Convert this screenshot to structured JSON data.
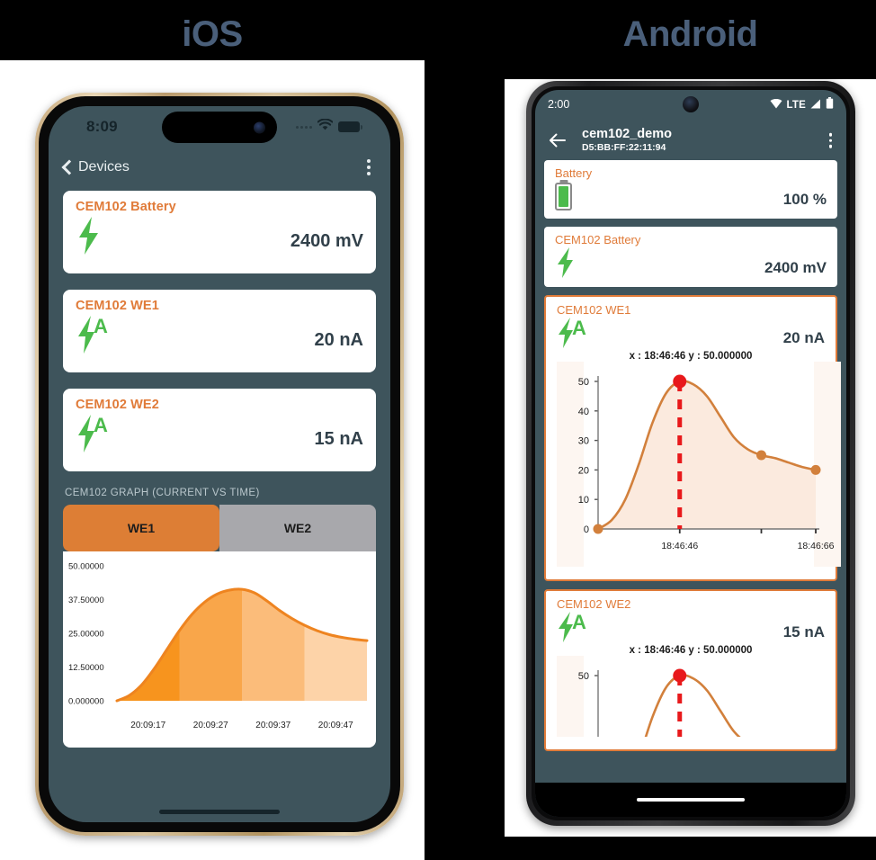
{
  "titles": {
    "ios": "iOS",
    "android": "Android"
  },
  "colors": {
    "app_background_teal": "#3e545c",
    "accent_orange": "#e07b39",
    "tab_active_orange": "#dd7e35",
    "tab_inactive_gray": "#a8a8ac",
    "value_text": "#31404a",
    "bolt_green": "#4cbb4c",
    "marker_red": "#e8191b",
    "platform_title": "#4a5f7a"
  },
  "ios": {
    "status_bar": {
      "time": "8:09",
      "icons": [
        "cellular-dots-icon",
        "wifi-icon",
        "battery-icon"
      ]
    },
    "nav_bar": {
      "back_label": "Devices",
      "back_icon": "chevron-left-icon",
      "overflow_icon": "overflow-menu-icon"
    },
    "cards": [
      {
        "title": "CEM102 Battery",
        "value": "2400 mV",
        "icon": "bolt-icon"
      },
      {
        "title": "CEM102 WE1",
        "value": "20 nA",
        "icon": "bolt-amp-icon"
      },
      {
        "title": "CEM102 WE2",
        "value": "15 nA",
        "icon": "bolt-amp-icon"
      }
    ],
    "graph": {
      "section_label": "CEM102 GRAPH (CURRENT VS TIME)",
      "tabs": [
        {
          "label": "WE1",
          "active": true
        },
        {
          "label": "WE2",
          "active": false
        }
      ]
    }
  },
  "android": {
    "status_bar": {
      "time": "2:00",
      "network_label": "LTE",
      "icons": [
        "wifi-icon",
        "signal-icon",
        "battery-icon"
      ]
    },
    "app_bar": {
      "back_icon": "arrow-left-icon",
      "title": "cem102_demo",
      "subtitle": "D5:BB:FF:22:11:94",
      "overflow_icon": "overflow-menu-icon"
    },
    "cards": [
      {
        "title": "Battery",
        "value": "100 %",
        "icon": "battery-full-icon",
        "selected": false
      },
      {
        "title": "CEM102 Battery",
        "value": "2400 mV",
        "icon": "bolt-icon",
        "selected": false
      },
      {
        "title": "CEM102 WE1",
        "value": "20 nA",
        "icon": "bolt-amp-icon",
        "selected": true
      },
      {
        "title": "CEM102 WE2",
        "value": "15 nA",
        "icon": "bolt-amp-icon",
        "selected": true
      }
    ],
    "readout_we1": "x : 18:46:46  y : 50.000000",
    "readout_we2": "x : 18:46:46  y : 50.000000"
  },
  "chart_data": [
    {
      "id": "ios-we1-chart",
      "type": "area",
      "title": "CEM102 GRAPH (CURRENT VS TIME)",
      "xlabel": "",
      "ylabel": "",
      "grid": false,
      "legend": "none",
      "ylim": [
        0,
        50
      ],
      "ytick_labels": [
        "0.000000",
        "12.50000",
        "25.00000",
        "37.50000",
        "50.00000"
      ],
      "ytick_values": [
        0,
        12.5,
        25,
        37.5,
        50
      ],
      "xtick_labels": [
        "20:09:17",
        "20:09:27",
        "20:09:37",
        "20:09:47"
      ],
      "x": [
        0,
        1,
        2,
        3,
        4,
        5,
        6,
        7,
        8,
        9,
        10,
        11,
        12,
        13,
        14,
        15,
        16,
        17,
        18,
        19,
        20
      ],
      "values": [
        0,
        2,
        6,
        12,
        19,
        26,
        32,
        36.5,
        39.5,
        41,
        41.3,
        40,
        37,
        33.5,
        30.5,
        28,
        26,
        24.5,
        23.5,
        22.8,
        22.3
      ]
    },
    {
      "id": "android-we1-chart",
      "type": "area",
      "title": "",
      "xlabel": "",
      "ylabel": "",
      "grid": false,
      "legend": "none",
      "ylim": [
        0,
        50
      ],
      "ytick_labels": [
        "0",
        "10",
        "20",
        "30",
        "40",
        "50"
      ],
      "ytick_values": [
        0,
        10,
        20,
        30,
        40,
        50
      ],
      "xtick_labels": [
        "18:46:46",
        "18:46:66"
      ],
      "x": [
        0,
        1,
        2,
        3,
        4,
        5,
        6,
        7,
        8,
        9,
        10,
        11,
        12,
        13,
        14,
        15,
        16
      ],
      "values": [
        0,
        3,
        10,
        22,
        36,
        46,
        50,
        49,
        45,
        38,
        31,
        27,
        25,
        24,
        22.5,
        21,
        20
      ],
      "annotations": [
        {
          "label": "x : 18:46:46  y : 50.000000",
          "x": 6,
          "y": 50
        }
      ],
      "markers": [
        {
          "x": 0,
          "y": 0,
          "color": "#d2803c",
          "highlight": false
        },
        {
          "x": 6,
          "y": 50,
          "color": "#e8191b",
          "highlight": true
        },
        {
          "x": 12,
          "y": 25,
          "color": "#d2803c",
          "highlight": false
        },
        {
          "x": 16,
          "y": 20,
          "color": "#d2803c",
          "highlight": false
        }
      ],
      "cursor_line": {
        "x": 6,
        "color": "#e8191b",
        "style": "dashed"
      }
    }
  ]
}
